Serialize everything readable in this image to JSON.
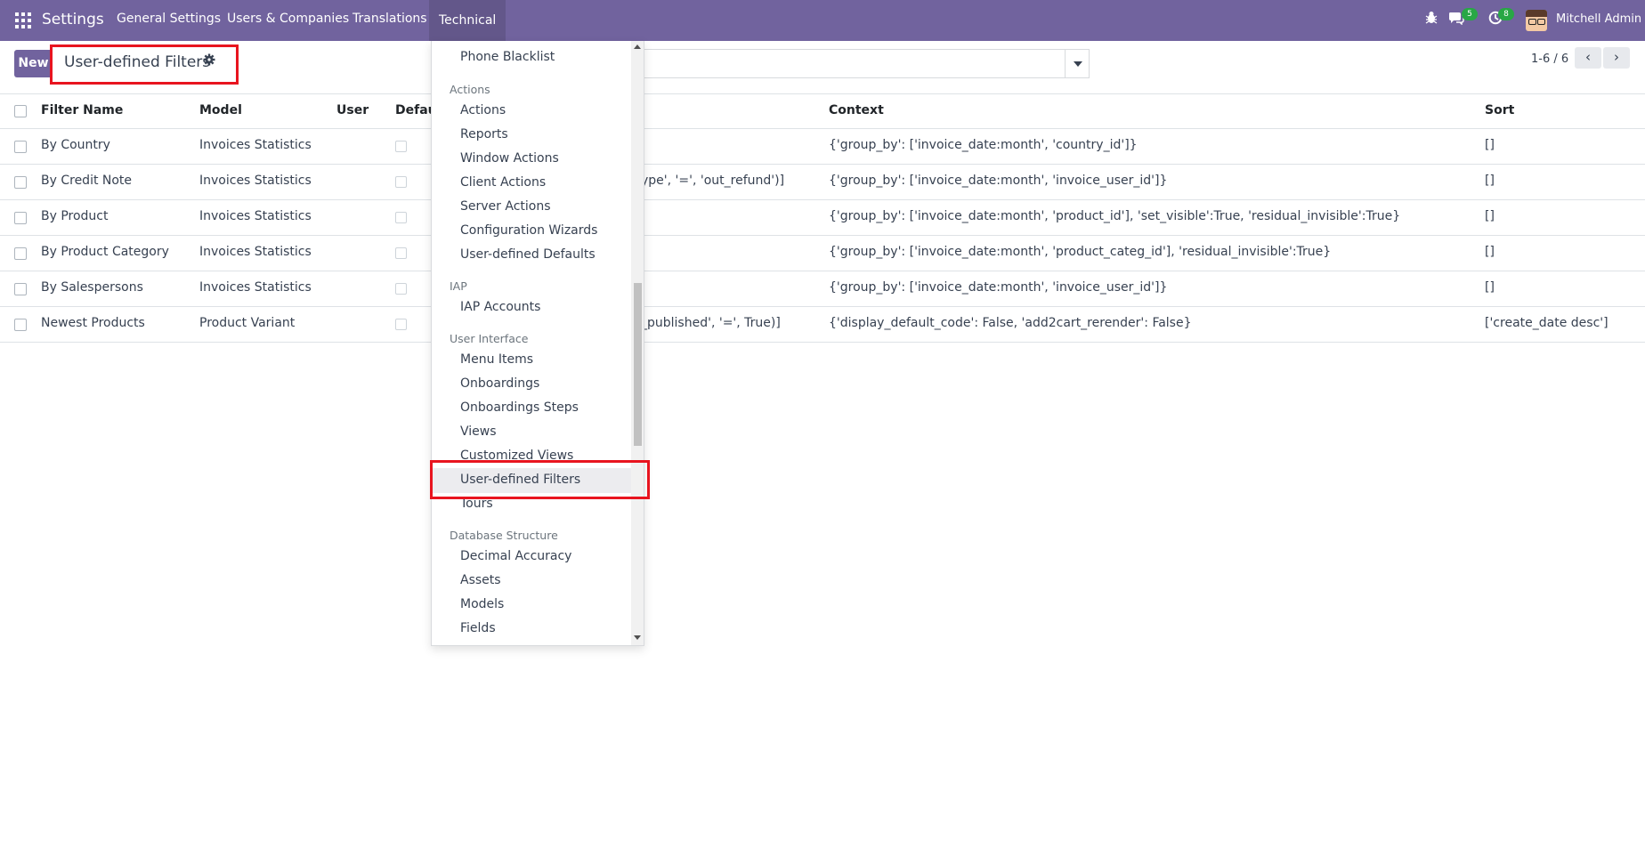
{
  "navbar": {
    "brand": "Settings",
    "menu": [
      "General Settings",
      "Users & Companies",
      "Translations",
      "Technical"
    ],
    "messages_badge": "5",
    "activities_badge": "8",
    "user_name": "Mitchell Admin"
  },
  "control": {
    "new_label": "New",
    "title": "User-defined Filters",
    "pager": "1-6 / 6",
    "pager_prev": "‹",
    "pager_next": "›"
  },
  "table": {
    "headers": [
      "Filter Name",
      "Model",
      "User",
      "Default",
      "Context",
      "Sort"
    ],
    "rows": [
      {
        "name": "By Country",
        "model": "Invoices Statistics",
        "domain": "",
        "context": "{'group_by': ['invoice_date:month', 'country_id']}",
        "sort": "[]"
      },
      {
        "name": "By Credit Note",
        "model": "Invoices Statistics",
        "domain": "ype', '=', 'out_refund')]",
        "context": "{'group_by': ['invoice_date:month', 'invoice_user_id']}",
        "sort": "[]"
      },
      {
        "name": "By Product",
        "model": "Invoices Statistics",
        "domain": "",
        "context": "{'group_by': ['invoice_date:month', 'product_id'], 'set_visible':True, 'residual_invisible':True}",
        "sort": "[]"
      },
      {
        "name": "By Product Category",
        "model": "Invoices Statistics",
        "domain": "",
        "context": "{'group_by': ['invoice_date:month', 'product_categ_id'], 'residual_invisible':True}",
        "sort": "[]"
      },
      {
        "name": "By Salespersons",
        "model": "Invoices Statistics",
        "domain": "",
        "context": "{'group_by': ['invoice_date:month', 'invoice_user_id']}",
        "sort": "[]"
      },
      {
        "name": "Newest Products",
        "model": "Product Variant",
        "domain": "_published', '=', True)]",
        "context": "{'display_default_code': False, 'add2cart_rerender': False}",
        "sort": "['create_date desc']"
      }
    ]
  },
  "dropdown": {
    "items": [
      {
        "type": "item",
        "label": "Phone Blacklist"
      },
      {
        "type": "header",
        "label": "Actions"
      },
      {
        "type": "item",
        "label": "Actions"
      },
      {
        "type": "item",
        "label": "Reports"
      },
      {
        "type": "item",
        "label": "Window Actions"
      },
      {
        "type": "item",
        "label": "Client Actions"
      },
      {
        "type": "item",
        "label": "Server Actions"
      },
      {
        "type": "item",
        "label": "Configuration Wizards"
      },
      {
        "type": "item",
        "label": "User-defined Defaults"
      },
      {
        "type": "header",
        "label": "IAP"
      },
      {
        "type": "item",
        "label": "IAP Accounts"
      },
      {
        "type": "header",
        "label": "User Interface"
      },
      {
        "type": "item",
        "label": "Menu Items"
      },
      {
        "type": "item",
        "label": "Onboardings"
      },
      {
        "type": "item",
        "label": "Onboardings Steps"
      },
      {
        "type": "item",
        "label": "Views"
      },
      {
        "type": "item",
        "label": "Customized Views"
      },
      {
        "type": "item",
        "label": "User-defined Filters",
        "active": true
      },
      {
        "type": "item",
        "label": "Tours"
      },
      {
        "type": "header",
        "label": "Database Structure"
      },
      {
        "type": "item",
        "label": "Decimal Accuracy"
      },
      {
        "type": "item",
        "label": "Assets"
      },
      {
        "type": "item",
        "label": "Models"
      },
      {
        "type": "item",
        "label": "Fields"
      }
    ]
  },
  "colors": {
    "brand": "#71639e",
    "highlight": "#e8141f",
    "badge": "#28a745"
  }
}
